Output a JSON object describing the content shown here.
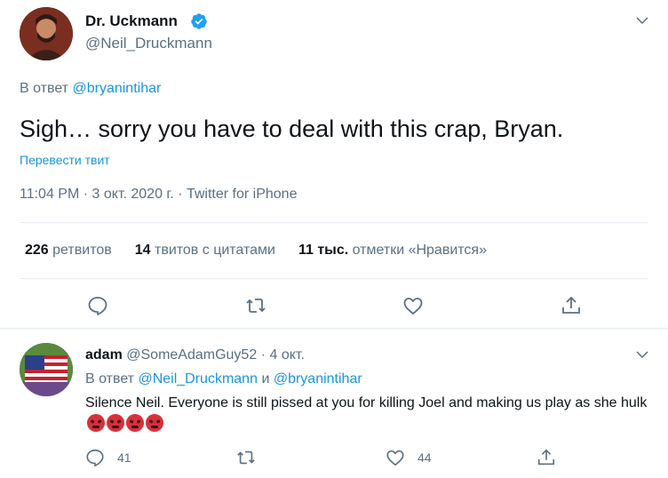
{
  "tweet": {
    "author_name": "Dr. Uckmann",
    "author_handle": "@Neil_Druckmann",
    "reply_prefix": "В ответ",
    "reply_to": "@bryanintihar",
    "text": "Sigh… sorry you have to deal with this crap, Bryan.",
    "translate_label": "Перевести твит",
    "meta": "11:04 PM · 3 окт. 2020 г. · Twitter for iPhone",
    "stats": {
      "retweets_count": "226",
      "retweets_label": "ретвитов",
      "quotes_count": "14",
      "quotes_label": "твитов с цитатами",
      "likes_count": "11 тыс.",
      "likes_label": "отметки «Нравится»"
    },
    "icons": [
      "reply-icon",
      "retweet-icon",
      "like-icon",
      "share-icon",
      "chevron-down-icon",
      "verified-badge-icon"
    ]
  },
  "reply": {
    "author_name": "adam",
    "author_handle": "@SomeAdamGuy52",
    "separator": "·",
    "date": "4 окт.",
    "reply_prefix": "В ответ",
    "reply_to_1": "@Neil_Druckmann",
    "reply_conj": "и",
    "reply_to_2": "@bryanintihar",
    "text": "Silence Neil. Everyone is still pissed at you for killing Joel and making us play as she hulk",
    "emoji_name": "angry-face-emoji",
    "reply_count": "41",
    "like_count": "44"
  },
  "colors": {
    "accent": "#1b95e0",
    "muted": "#5b7083",
    "text": "#0f1419",
    "divider": "#e6ecf0",
    "verified": "#1da1f2"
  }
}
